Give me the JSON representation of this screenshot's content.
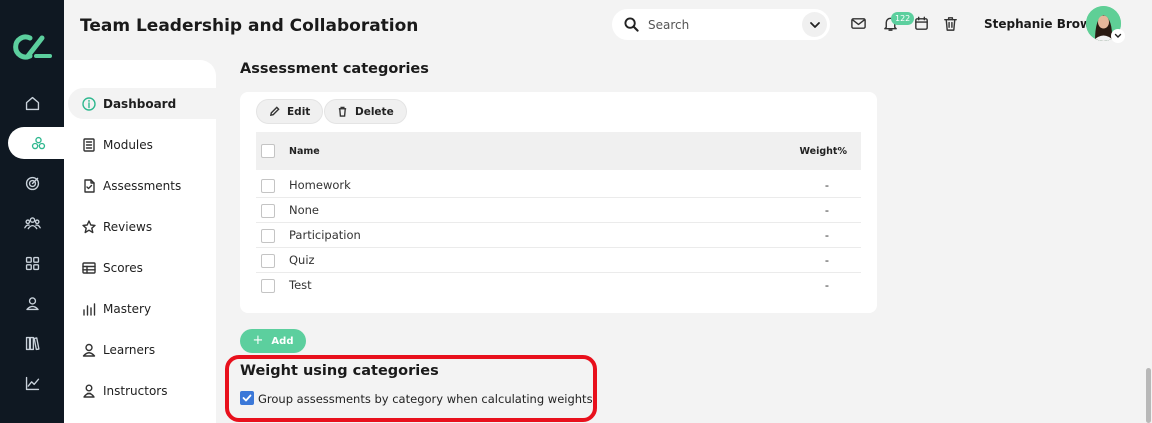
{
  "header": {
    "title": "Team Leadership and Collaboration",
    "search_placeholder": "Search",
    "notification_count": "122",
    "user_name": "Stephanie Brown"
  },
  "rail": {
    "items": [
      "home-icon",
      "modules-icon",
      "target-icon",
      "group-icon",
      "apps-grid-icon",
      "person-icon",
      "library-icon",
      "analytics-icon"
    ],
    "active": "modules-icon"
  },
  "subnav": {
    "items": [
      {
        "label": "Dashboard",
        "icon": "info-icon"
      },
      {
        "label": "Modules",
        "icon": "module-icon"
      },
      {
        "label": "Assessments",
        "icon": "document-icon"
      },
      {
        "label": "Reviews",
        "icon": "star-icon"
      },
      {
        "label": "Scores",
        "icon": "table-icon"
      },
      {
        "label": "Mastery",
        "icon": "bar-chart-icon"
      },
      {
        "label": "Learners",
        "icon": "learner-icon"
      },
      {
        "label": "Instructors",
        "icon": "instructor-icon"
      }
    ],
    "active": "Dashboard"
  },
  "main": {
    "section_title": "Assessment categories",
    "toolbar": {
      "edit_label": "Edit",
      "delete_label": "Delete"
    },
    "table": {
      "columns": [
        "Name",
        "Weight%"
      ],
      "rows": [
        {
          "name": "Homework",
          "weight": "-"
        },
        {
          "name": "None",
          "weight": "-"
        },
        {
          "name": "Participation",
          "weight": "-"
        },
        {
          "name": "Quiz",
          "weight": "-"
        },
        {
          "name": "Test",
          "weight": "-"
        }
      ]
    },
    "add_label": "Add",
    "weight_section": {
      "title": "Weight using categories",
      "checkbox_label": "Group assessments by category when calculating weights",
      "checked": true
    }
  },
  "colors": {
    "accent": "#5ccf9e",
    "rail_bg": "#0f1822",
    "highlight": "#e8101c",
    "checkbox": "#3b78d8"
  }
}
